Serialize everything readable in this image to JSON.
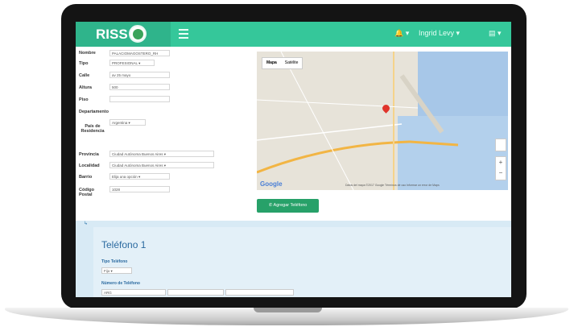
{
  "brand": {
    "name": "RISS"
  },
  "topbar": {
    "bell": "🔔 ▾",
    "user": "Ingrid Levy ▾",
    "menu": "▤ ▾"
  },
  "form": {
    "rows": [
      {
        "label": "Nombre",
        "value": "PALACIOMAGOSTERO_RH"
      },
      {
        "label": "Tipo",
        "value": "PROFESIONAL ▾"
      },
      {
        "label": "Calle",
        "value": "av 25 mayo"
      },
      {
        "label": "Altura",
        "value": "500"
      },
      {
        "label": "Piso",
        "value": ""
      },
      {
        "label": "Departamento",
        "value": ""
      },
      {
        "label": "País de Residencia",
        "value": "Argentina ▾"
      },
      {
        "label": "Provincia",
        "value": "Ciudad Autónoma Buenos Aires ▾"
      },
      {
        "label": "Localidad",
        "value": "Ciudad Autónoma Buenos Aires ▾"
      },
      {
        "label": "Barrio",
        "value": "Elija una opción ▾"
      },
      {
        "label": "Código Postal",
        "value": "1028"
      }
    ]
  },
  "map": {
    "type_map": "Mapa",
    "type_sat": "Satélite",
    "google": "Google",
    "footer": "Datos del mapa ©2017 Google   Términos de uso   Informar un error de Maps",
    "zoom_in": "+",
    "zoom_out": "−"
  },
  "actions": {
    "add_phone": "✆ Agregar Teléfono"
  },
  "phone": {
    "title": "Teléfono 1",
    "type_label": "Tipo Teléfono",
    "type_value": "Fijo ▾",
    "number_label": "Número de Teléfono",
    "number_value": "ARG"
  }
}
